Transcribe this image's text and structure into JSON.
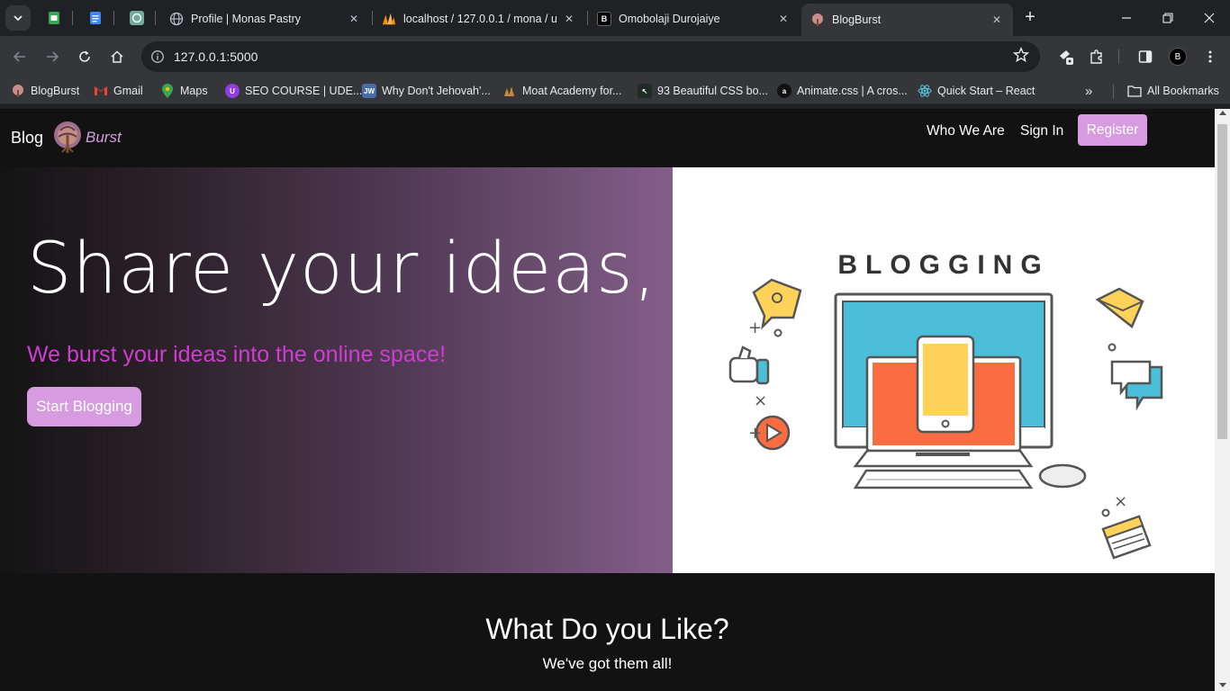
{
  "browser": {
    "tabs": [
      {
        "title": "Profile | Monas Pastry"
      },
      {
        "title": "localhost / 127.0.0.1 / mona / u"
      },
      {
        "title": "Omobolaji Durojaiye"
      },
      {
        "title": "BlogBurst"
      }
    ],
    "url": "127.0.0.1:5000",
    "profile_initial": "B",
    "bookmarks": [
      {
        "label": "BlogBurst"
      },
      {
        "label": "Gmail"
      },
      {
        "label": "Maps"
      },
      {
        "label": "SEO COURSE | UDE..."
      },
      {
        "label": "Why Don't Jehovah'..."
      },
      {
        "label": "Moat Academy for..."
      },
      {
        "label": "93 Beautiful CSS bo..."
      },
      {
        "label": "Animate.css | A cros..."
      },
      {
        "label": "Quick Start – React"
      }
    ],
    "all_bookmarks": "All Bookmarks"
  },
  "page": {
    "brand": {
      "blog": "Blog",
      "burst": "Burst"
    },
    "nav": {
      "who_we_are": "Who We Are",
      "sign_in": "Sign In",
      "register": "Register"
    },
    "hero": {
      "title": "Share your ideas,",
      "subtitle": "We burst your ideas into the online space!",
      "cta": "Start Blogging",
      "illustration_caption": "BLOGGING"
    },
    "section": {
      "title": "What Do you Like?",
      "subtitle": "We've got them all!"
    }
  },
  "colors": {
    "accent": "#d79be0",
    "subtitle": "#cd3ed0",
    "background": "#121212"
  }
}
